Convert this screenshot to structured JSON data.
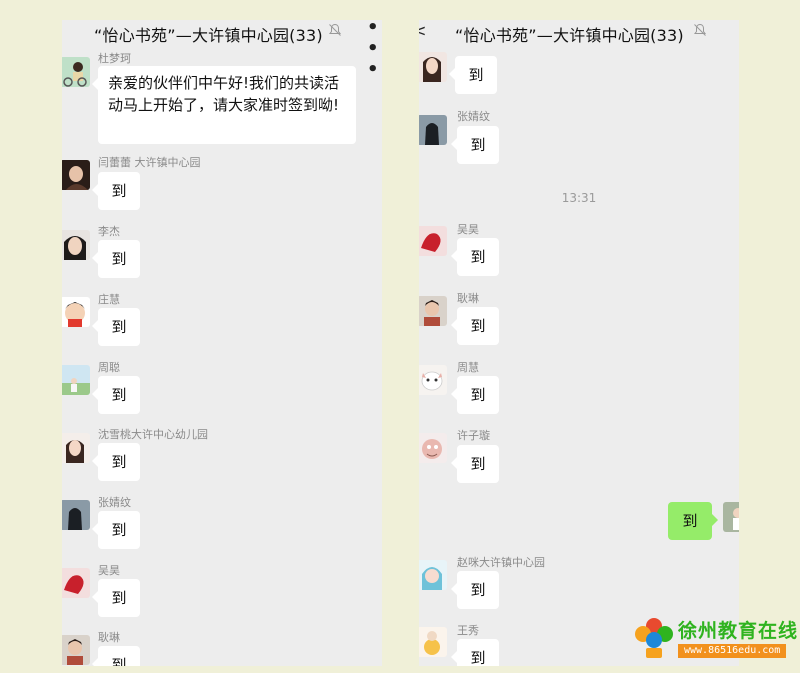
{
  "left": {
    "title": "“怡心书苑”—大许镇中心园(33)",
    "messages": [
      {
        "name": "杜梦珂",
        "text": "亲爱的伙伴们中午好!我们的共读活动马上开始了，请大家准时签到呦!"
      },
      {
        "name": "闫蕾蕾  大许镇中心园",
        "text": "到"
      },
      {
        "name": "李杰",
        "text": "到"
      },
      {
        "name": "庄慧",
        "text": "到"
      },
      {
        "name": "周聪",
        "text": "到"
      },
      {
        "name": "沈雪桃大许中心幼儿园",
        "text": "到"
      },
      {
        "name": "张婧纹",
        "text": "到"
      },
      {
        "name": "吴昊",
        "text": "到"
      },
      {
        "name": "耿琳",
        "text": "到"
      }
    ]
  },
  "right": {
    "title": "“怡心书苑”—大许镇中心园(33)",
    "back": "<",
    "time": "13:31",
    "messages": [
      {
        "name": "",
        "text": "到"
      },
      {
        "name": "张婧纹",
        "text": "到"
      },
      {
        "name": "吴昊",
        "text": "到"
      },
      {
        "name": "耿琳",
        "text": "到"
      },
      {
        "name": "周慧",
        "text": "到"
      },
      {
        "name": "许子璇",
        "text": "到"
      },
      {
        "name": "",
        "text": "到",
        "self": true
      },
      {
        "name": "赵咪大许镇中心园",
        "text": "到"
      },
      {
        "name": "王秀",
        "text": "到"
      }
    ]
  },
  "more_icon": "• • •",
  "watermark": {
    "title": "徐州教育在线",
    "url": "www.86516edu.com"
  }
}
